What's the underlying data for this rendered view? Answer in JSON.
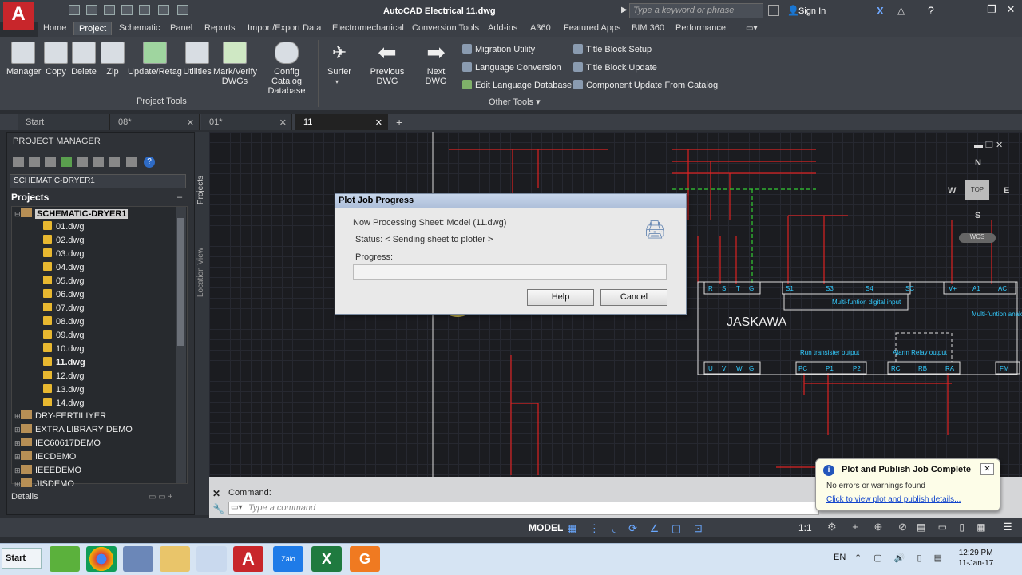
{
  "title_bar": {
    "app_title": "AutoCAD Electrical     11.dwg",
    "search_placeholder": "Type a keyword or phrase",
    "sign_in": "Sign In"
  },
  "ribbon_tabs": [
    "Home",
    "Project",
    "Schematic",
    "Panel",
    "Reports",
    "Import/Export Data",
    "Electromechanical",
    "Conversion Tools",
    "Add-ins",
    "A360",
    "Featured Apps",
    "BIM 360",
    "Performance"
  ],
  "active_tab": "Project",
  "ribbon": {
    "project_tools": [
      "Manager",
      "Copy",
      "Delete",
      "Zip",
      "Update/Retag",
      "Utilities",
      "Mark/Verify\nDWGs",
      "Config Catalog\nDatabase"
    ],
    "project_tools_label": "Project Tools",
    "nav": [
      "Surfer",
      "Previous DWG",
      "Next DWG"
    ],
    "other_tools_left": [
      "Migration Utility",
      "Language Conversion",
      "Edit Language Database"
    ],
    "other_tools_right": [
      "Title Block Setup",
      "Title Block Update",
      "Component Update From Catalog"
    ],
    "other_tools_label": "Other Tools"
  },
  "doc_tabs": [
    "Start",
    "08*",
    "01*",
    "11"
  ],
  "active_doc": "11",
  "project_manager": {
    "title": "PROJECT MANAGER",
    "combo_value": "SCHEMATIC-DRYER1",
    "projects_label": "Projects",
    "active_project": "SCHEMATIC-DRYER1",
    "drawings": [
      "01.dwg",
      "02.dwg",
      "03.dwg",
      "04.dwg",
      "05.dwg",
      "06.dwg",
      "07.dwg",
      "08.dwg",
      "09.dwg",
      "10.dwg",
      "11.dwg",
      "12.dwg",
      "13.dwg",
      "14.dwg"
    ],
    "active_drawing": "11.dwg",
    "other_projects": [
      "DRY-FERTILIYER",
      "EXTRA LIBRARY DEMO",
      "IEC60617DEMO",
      "IECDEMO",
      "IEEEDEMO",
      "JISDEMO"
    ],
    "details_label": "Details",
    "side_tabs": [
      "Projects",
      "Location View"
    ]
  },
  "drawing": {
    "drive_label": "JASKAWA",
    "terminals_top": [
      "R",
      "S",
      "T",
      "G",
      "S1",
      "S3",
      "S4",
      "SC",
      "V+",
      "A1",
      "AC"
    ],
    "terminals_bottom": [
      "U",
      "V",
      "W",
      "G",
      "PC",
      "P1",
      "P2",
      "RC",
      "RB",
      "RA",
      "FM"
    ],
    "labels": [
      "Multi-funtion\ndigital input",
      "Multi-funtion\nanalog in",
      "Run transister\noutput",
      "Alarm Relay\noutput"
    ],
    "viewcube": {
      "n": "N",
      "s": "S",
      "e": "E",
      "w": "W",
      "top": "TOP",
      "wcs": "WCS"
    }
  },
  "command": {
    "label": "Command:",
    "placeholder": "Type a command"
  },
  "status": {
    "model": "MODEL",
    "scale": "1:1"
  },
  "dialog": {
    "title": "Plot Job Progress",
    "processing": "Now Processing Sheet: Model (11.dwg)",
    "status": "Status: < Sending sheet to plotter >",
    "progress_label": "Progress:",
    "progress_value": 0,
    "help": "Help",
    "cancel": "Cancel"
  },
  "toast": {
    "title": "Plot and Publish Job Complete",
    "message": "No errors or warnings found",
    "link": "Click to view plot and publish details..."
  },
  "taskbar": {
    "start": "Start",
    "lang": "EN",
    "time": "12:29 PM",
    "date": "11-Jan-17"
  }
}
